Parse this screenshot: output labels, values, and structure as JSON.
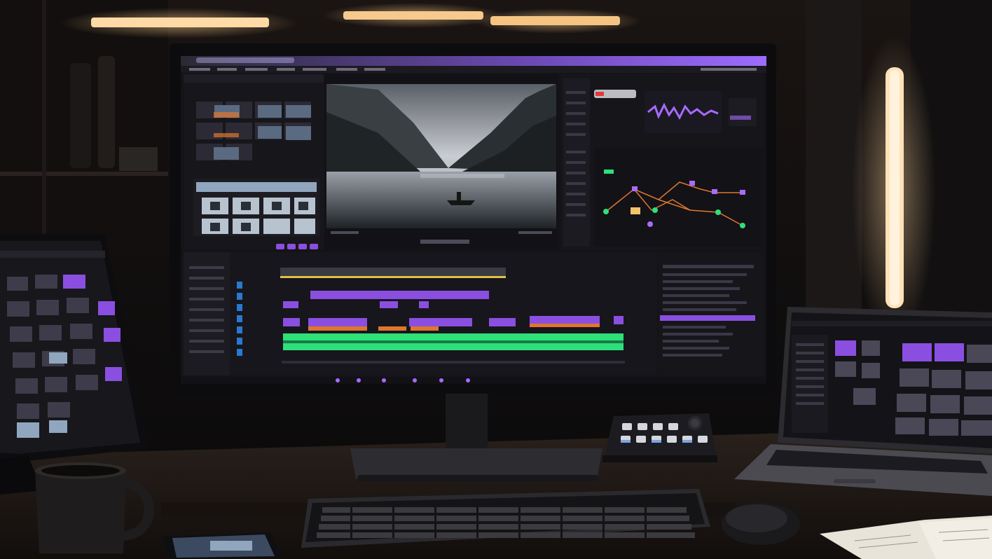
{
  "scene": {
    "description_free": true,
    "colors": {
      "accent": "#8a4fe0",
      "accent_light": "#a86bff",
      "track_green": "#2ee07a",
      "track_orange": "#e0762e",
      "wall_light": "#ffd7a0",
      "desk": "#1b1614",
      "bezel": "#0c0c0e",
      "panel": "#1a191f",
      "panel_dark": "#121116"
    },
    "icons": [
      "monitor-icon",
      "tablet-icon",
      "laptop-icon",
      "keyboard-icon",
      "mouse-icon",
      "mug-icon",
      "phone-icon",
      "stream-deck-icon",
      "notebook-icon",
      "light-bar-icon"
    ]
  }
}
